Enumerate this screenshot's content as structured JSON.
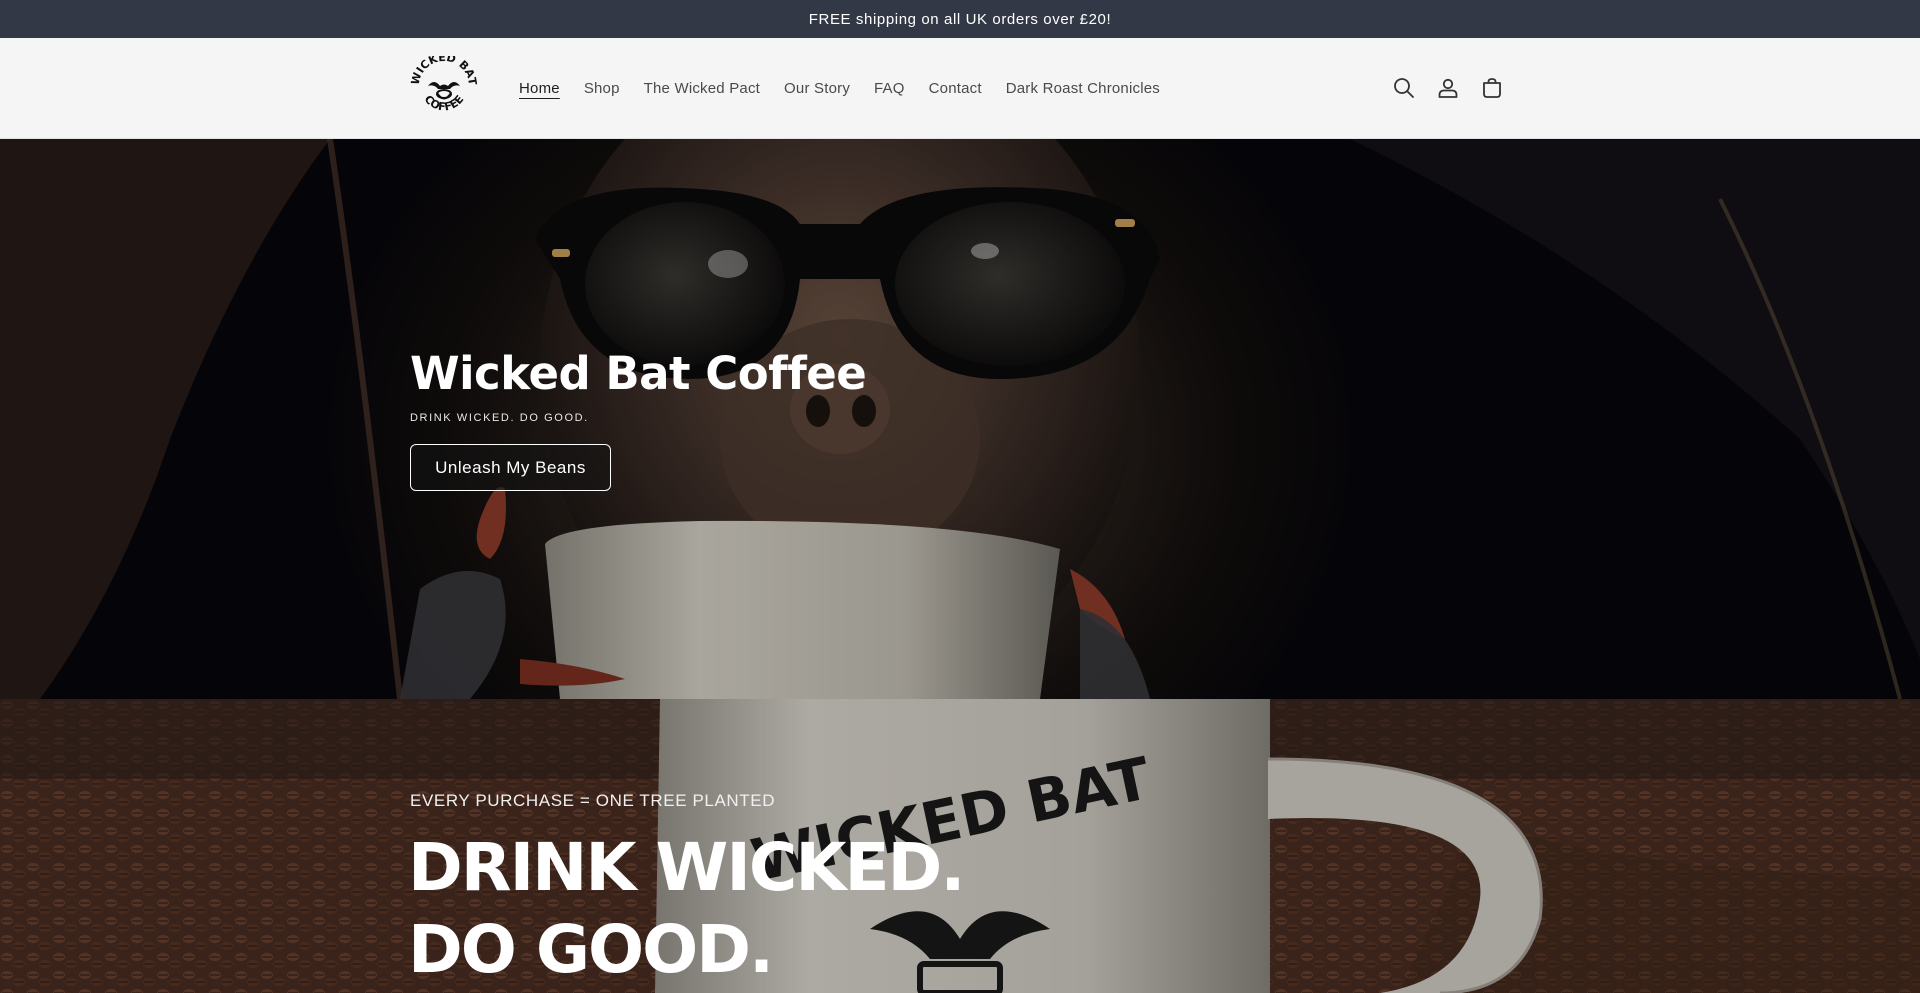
{
  "announcement": {
    "text": "FREE shipping on all UK orders over £20!"
  },
  "header": {
    "logo_text": "WICKED BAT COFFEE",
    "nav": [
      {
        "label": "Home",
        "active": true
      },
      {
        "label": "Shop",
        "active": false
      },
      {
        "label": "The Wicked Pact",
        "active": false
      },
      {
        "label": "Our Story",
        "active": false
      },
      {
        "label": "FAQ",
        "active": false
      },
      {
        "label": "Contact",
        "active": false
      },
      {
        "label": "Dark Roast Chronicles",
        "active": false
      }
    ],
    "icons": [
      "search-icon",
      "account-icon",
      "cart-icon"
    ]
  },
  "hero": {
    "title": "Wicked Bat Coffee",
    "subtitle": "DRINK WICKED. DO GOOD.",
    "button_label": "Unleash My Beans"
  },
  "banner": {
    "kicker": "EVERY PURCHASE = ONE TREE PLANTED",
    "title": "DRINK WICKED. DO GOOD.",
    "mug_text": "WICKED BAT"
  },
  "colors": {
    "announcement_bg": "#323846",
    "header_bg": "#f5f5f5",
    "text_dark": "#1f1f1f",
    "text_nav": "#4a4a4a",
    "white": "#ffffff"
  }
}
